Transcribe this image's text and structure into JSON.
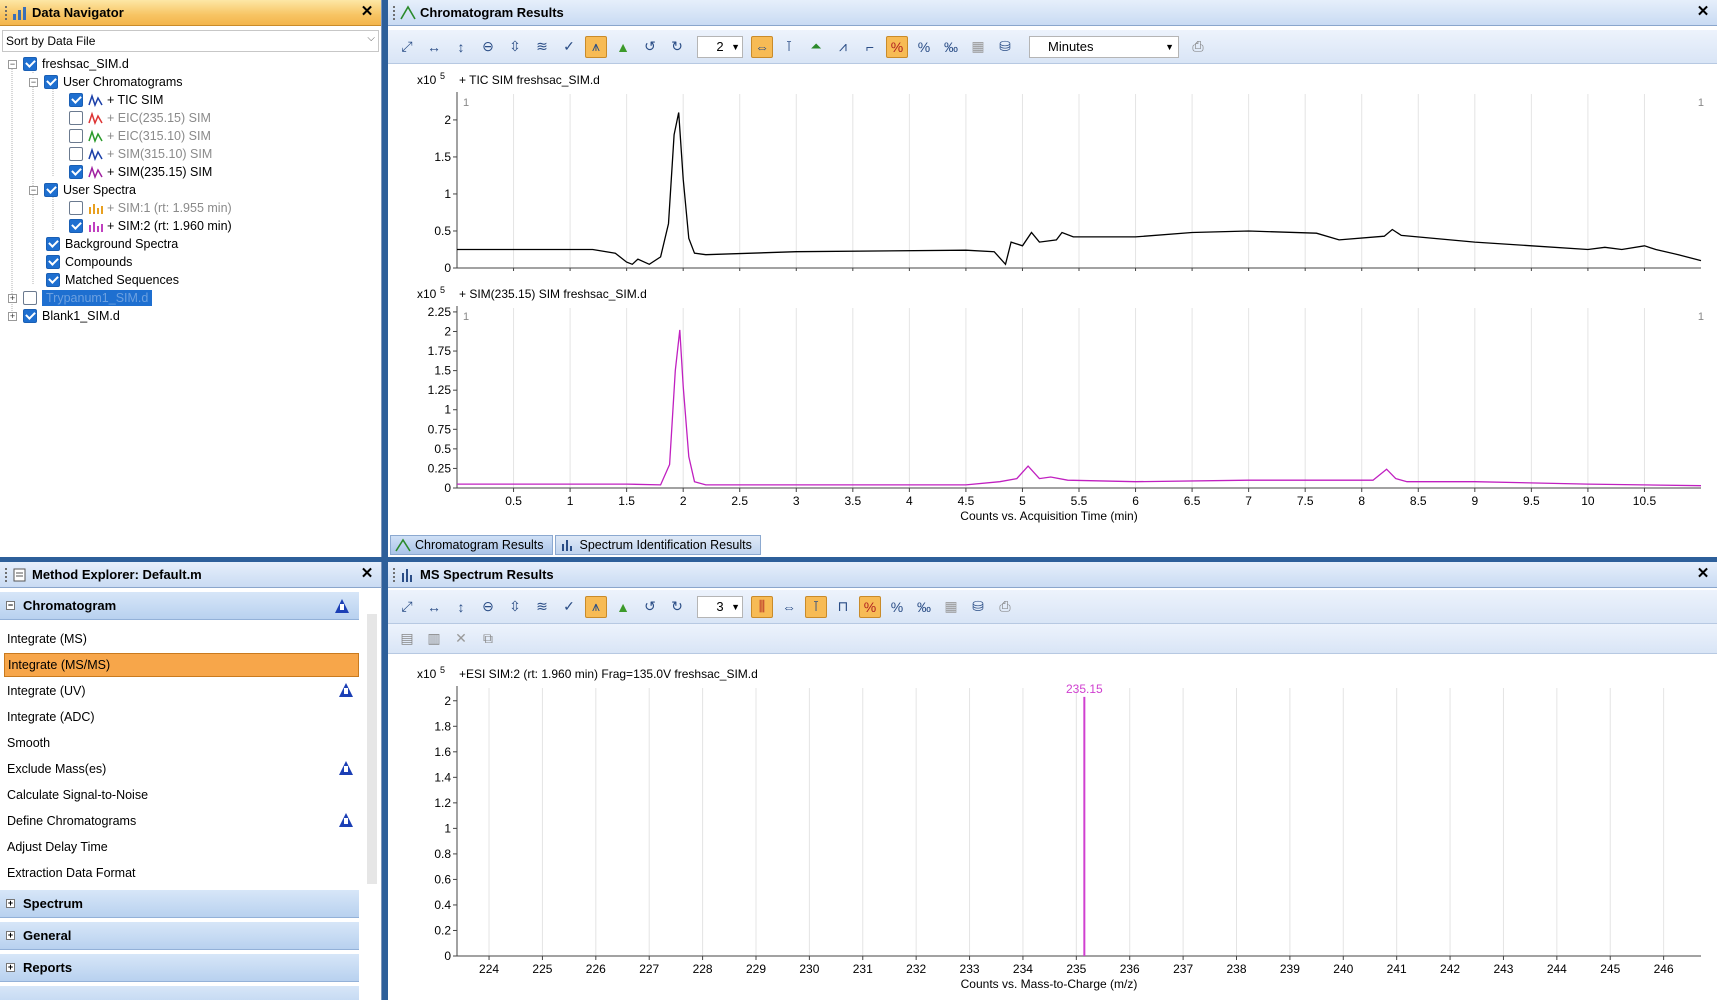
{
  "data_navigator": {
    "title": "Data Navigator",
    "sort_label": "Sort by Data File",
    "tree": [
      {
        "label": "freshsac_SIM.d",
        "checked": true,
        "expander": "−"
      },
      {
        "label": "User Chromatograms",
        "checked": true,
        "expander": "−"
      },
      {
        "label": "+ TIC SIM",
        "checked": true
      },
      {
        "label": "+ EIC(235.15) SIM",
        "checked": false
      },
      {
        "label": "+ EIC(315.10) SIM",
        "checked": false
      },
      {
        "label": "+ SIM(315.10) SIM",
        "checked": false
      },
      {
        "label": "+ SIM(235.15) SIM",
        "checked": true
      },
      {
        "label": "User Spectra",
        "checked": true,
        "expander": "−"
      },
      {
        "label": "+ SIM:1 (rt: 1.955 min)",
        "checked": false
      },
      {
        "label": "+ SIM:2 (rt: 1.960 min)",
        "checked": true
      },
      {
        "label": "Background Spectra",
        "checked": true
      },
      {
        "label": "Compounds",
        "checked": true
      },
      {
        "label": "Matched Sequences",
        "checked": true
      },
      {
        "label": "Trypanum1_SIM.d",
        "checked": false,
        "expander": "+"
      },
      {
        "label": "Blank1_SIM.d",
        "checked": true,
        "expander": "+"
      }
    ]
  },
  "method_explorer": {
    "title": "Method Explorer: Default.m",
    "section_chromatogram": "Chromatogram",
    "items": [
      {
        "label": "Integrate (MS)",
        "warn": false
      },
      {
        "label": "Integrate (MS/MS)",
        "warn": false,
        "active": true
      },
      {
        "label": "Integrate (UV)",
        "warn": true
      },
      {
        "label": "Integrate (ADC)",
        "warn": false
      },
      {
        "label": "Smooth",
        "warn": false
      },
      {
        "label": "Exclude Mass(es)",
        "warn": true
      },
      {
        "label": "Calculate Signal-to-Noise",
        "warn": false
      },
      {
        "label": "Define Chromatograms",
        "warn": true
      },
      {
        "label": "Adjust Delay Time",
        "warn": false
      },
      {
        "label": "Extraction Data Format",
        "warn": false
      }
    ],
    "section_spectrum": "Spectrum",
    "section_general": "General",
    "section_reports": "Reports"
  },
  "chromatogram_results": {
    "title": "Chromatogram Results",
    "overlay_count": "2",
    "units": "Minutes",
    "tabs": {
      "chromatogram": "Chromatogram Results",
      "spectrum_id": "Spectrum Identification Results"
    }
  },
  "ms_spectrum_results": {
    "title": "MS Spectrum Results",
    "overlay_count": "3"
  },
  "chart_data": [
    {
      "type": "line",
      "title": "+ TIC SIM freshsac_SIM.d",
      "y_multiplier": "x10",
      "y_exponent": "5",
      "corner_label": "1",
      "color": "#000000",
      "xlim": [
        0,
        11
      ],
      "ylim": [
        0,
        2.35
      ],
      "x_ticks": [
        0.5,
        1,
        1.5,
        2,
        2.5,
        3,
        3.5,
        4,
        4.5,
        5,
        5.5,
        6,
        6.5,
        7,
        7.5,
        8,
        8.5,
        9,
        9.5,
        10,
        10.5
      ],
      "y_ticks": [
        "0",
        "0.5",
        "1",
        "1.5",
        "2"
      ],
      "x": [
        0,
        1.2,
        1.4,
        1.5,
        1.55,
        1.6,
        1.7,
        1.8,
        1.87,
        1.92,
        1.96,
        2.0,
        2.05,
        2.1,
        2.2,
        3.0,
        4.5,
        4.75,
        4.85,
        4.9,
        5.0,
        5.08,
        5.15,
        5.3,
        5.35,
        5.45,
        6.0,
        6.5,
        7.0,
        7.6,
        7.8,
        8.2,
        8.27,
        8.35,
        9.0,
        9.5,
        10.0,
        10.15,
        10.3,
        10.5,
        10.6,
        10.8,
        11.0
      ],
      "y": [
        0.25,
        0.25,
        0.2,
        0.08,
        0.05,
        0.12,
        0.05,
        0.15,
        0.6,
        1.8,
        2.1,
        1.2,
        0.4,
        0.2,
        0.18,
        0.22,
        0.24,
        0.22,
        0.05,
        0.35,
        0.3,
        0.48,
        0.35,
        0.38,
        0.48,
        0.42,
        0.42,
        0.48,
        0.5,
        0.47,
        0.38,
        0.43,
        0.52,
        0.44,
        0.35,
        0.3,
        0.25,
        0.28,
        0.25,
        0.3,
        0.25,
        0.18,
        0.1
      ]
    },
    {
      "type": "line",
      "title": "+ SIM(235.15) SIM freshsac_SIM.d",
      "y_multiplier": "x10",
      "y_exponent": "5",
      "corner_label": "1",
      "color": "#c020c0",
      "xlim": [
        0,
        11
      ],
      "ylim": [
        0,
        2.3
      ],
      "x_ticks": [
        0.5,
        1,
        1.5,
        2,
        2.5,
        3,
        3.5,
        4,
        4.5,
        5,
        5.5,
        6,
        6.5,
        7,
        7.5,
        8,
        8.5,
        9,
        9.5,
        10,
        10.5
      ],
      "x_tick_labels": [
        "0.5",
        "1",
        "1.5",
        "2",
        "2.5",
        "3",
        "3.5",
        "4",
        "4.5",
        "5",
        "5.5",
        "6",
        "6.5",
        "7",
        "7.5",
        "8",
        "8.5",
        "9",
        "9.5",
        "10",
        "10.5"
      ],
      "y_ticks": [
        "0",
        "0.25",
        "0.5",
        "0.75",
        "1",
        "1.25",
        "1.5",
        "1.75",
        "2",
        "2.25"
      ],
      "xlabel": "Counts vs. Acquisition Time (min)",
      "x": [
        0,
        1.5,
        1.8,
        1.88,
        1.93,
        1.97,
        2.0,
        2.05,
        2.1,
        2.2,
        3.0,
        4.5,
        4.8,
        4.95,
        5.05,
        5.15,
        5.25,
        5.4,
        6.0,
        7.0,
        8.1,
        8.22,
        8.3,
        8.4,
        9.0,
        10.0,
        11.0
      ],
      "y": [
        0.05,
        0.05,
        0.04,
        0.3,
        1.5,
        2.02,
        1.3,
        0.4,
        0.08,
        0.04,
        0.04,
        0.04,
        0.08,
        0.12,
        0.28,
        0.12,
        0.14,
        0.1,
        0.08,
        0.1,
        0.1,
        0.24,
        0.12,
        0.08,
        0.08,
        0.05,
        0.03
      ]
    },
    {
      "type": "bar",
      "title": "+ESI SIM:2 (rt: 1.960 min) Frag=135.0V freshsac_SIM.d",
      "y_multiplier": "x10",
      "y_exponent": "5",
      "color": "#d040d0",
      "xlim": [
        223.4,
        246.7
      ],
      "ylim": [
        0,
        2.1
      ],
      "x_ticks": [
        224,
        225,
        226,
        227,
        228,
        229,
        230,
        231,
        232,
        233,
        234,
        235,
        236,
        237,
        238,
        239,
        240,
        241,
        242,
        243,
        244,
        245,
        246
      ],
      "y_ticks": [
        "0",
        "0.2",
        "0.4",
        "0.6",
        "0.8",
        "1",
        "1.2",
        "1.4",
        "1.6",
        "1.8",
        "2"
      ],
      "xlabel": "Counts vs. Mass-to-Charge (m/z)",
      "peaks": [
        {
          "mz": 235.15,
          "value": 2.03,
          "label": "235.15"
        }
      ]
    }
  ]
}
